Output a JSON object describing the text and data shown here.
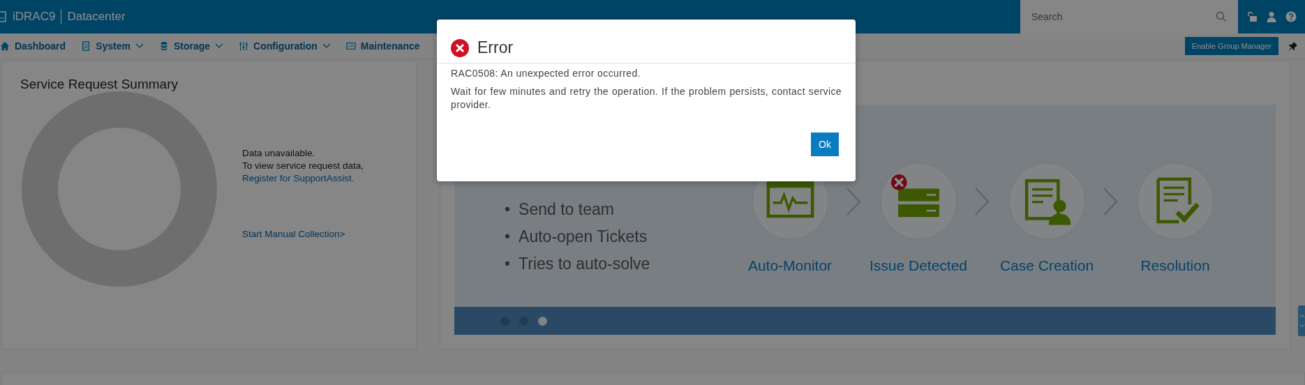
{
  "header": {
    "product": "iDRAC9",
    "edition": "Datacenter",
    "search": {
      "placeholder": "Search"
    }
  },
  "nav": [
    {
      "label": "Dashboard",
      "kind": "home",
      "dropdown": false
    },
    {
      "label": "System",
      "kind": "server",
      "dropdown": true
    },
    {
      "label": "Storage",
      "kind": "database",
      "dropdown": true
    },
    {
      "label": "Configuration",
      "kind": "sliders",
      "dropdown": true
    },
    {
      "label": "Maintenance",
      "kind": "image",
      "dropdown": false
    }
  ],
  "enable_group_manager": "Enable Group Manager",
  "service_request_summary": {
    "title": "Service Request Summary",
    "lines": [
      "Data unavailable.",
      "To view service request data,"
    ],
    "register_link": "Register for SupportAssist.",
    "manual_link": "Start Manual Collection>"
  },
  "carousel": {
    "bullets": [
      {
        "marker": "•",
        "text": "Send to team"
      },
      {
        "marker": "•",
        "text": "Auto-open Tickets"
      },
      {
        "marker": "•",
        "text": "Tries to auto-solve"
      }
    ],
    "steps": [
      {
        "label": "Auto-Monitor",
        "kind": "monitor"
      },
      {
        "label": "Issue Detected",
        "kind": "server-error"
      },
      {
        "label": "Case Creation",
        "kind": "case"
      },
      {
        "label": "Resolution",
        "kind": "resolution"
      }
    ],
    "dots": [
      {
        "selected": false
      },
      {
        "selected": false
      },
      {
        "selected": true
      }
    ]
  },
  "dialog": {
    "title": "Error",
    "message": "RAC0508: An unexpected error occurred.",
    "detail": "Wait for few minutes and retry the operation. If the problem persists, contact service provider.",
    "ok": "Ok"
  }
}
